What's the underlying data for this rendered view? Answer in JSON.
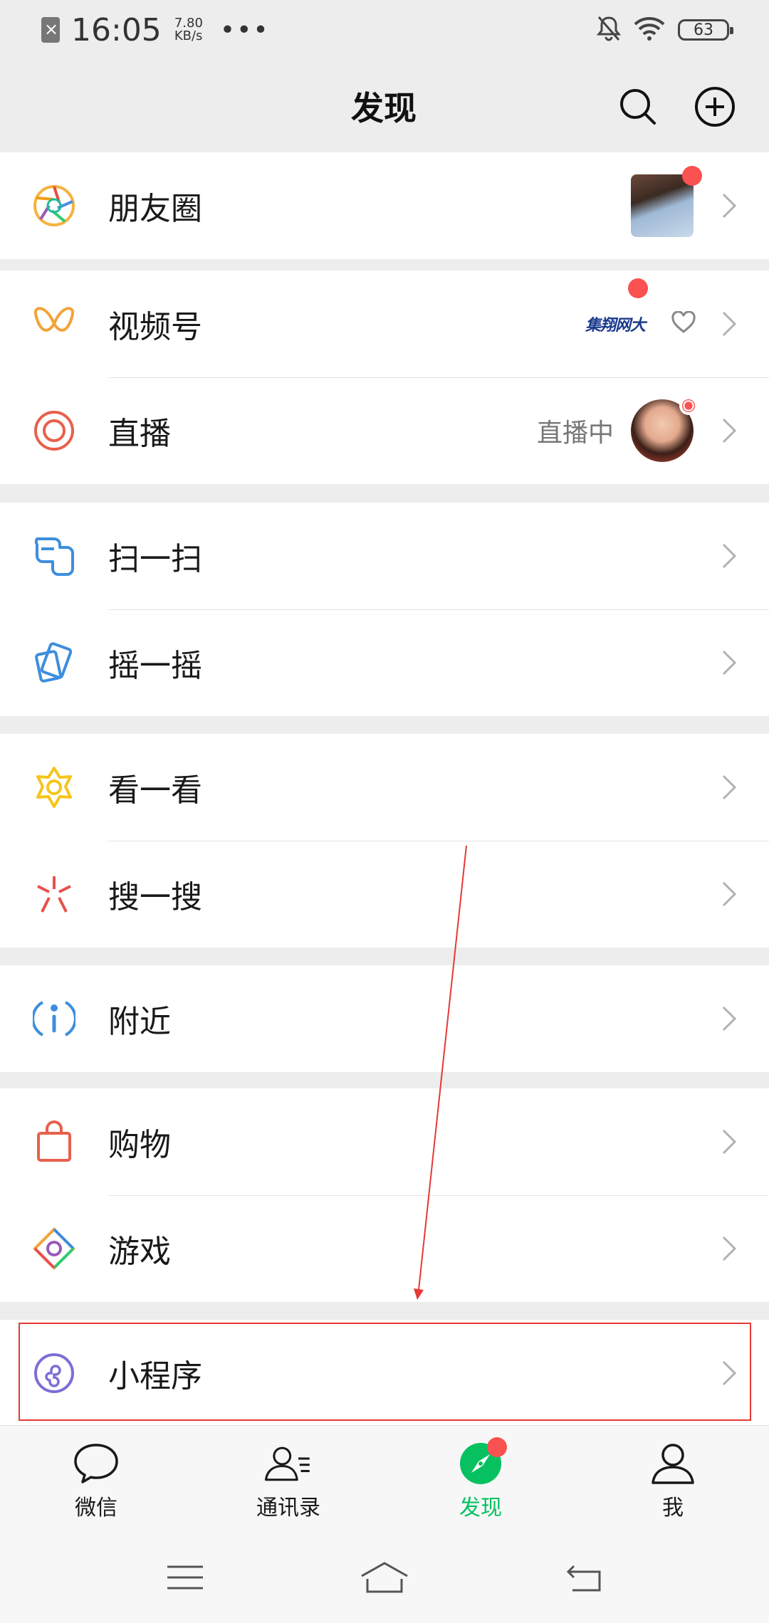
{
  "status_bar": {
    "time": "16:05",
    "speed_value": "7.80",
    "speed_unit": "KB/s",
    "more": "•••",
    "battery": "63"
  },
  "header": {
    "title": "发现"
  },
  "groups": {
    "moments": {
      "label": "朋友圈"
    },
    "channels": {
      "label": "视频号",
      "brand": "集翔网大"
    },
    "live": {
      "label": "直播",
      "status": "直播中"
    },
    "scan": {
      "label": "扫一扫"
    },
    "shake": {
      "label": "摇一摇"
    },
    "top_stories": {
      "label": "看一看"
    },
    "search": {
      "label": "搜一搜"
    },
    "nearby": {
      "label": "附近"
    },
    "shopping": {
      "label": "购物"
    },
    "games": {
      "label": "游戏"
    },
    "mini_programs": {
      "label": "小程序"
    }
  },
  "tabbar": {
    "chats": "微信",
    "contacts": "通讯录",
    "discover": "发现",
    "me": "我"
  },
  "colors": {
    "accent": "#07c160",
    "badge": "#fa5151",
    "annotation": "#e53935"
  }
}
